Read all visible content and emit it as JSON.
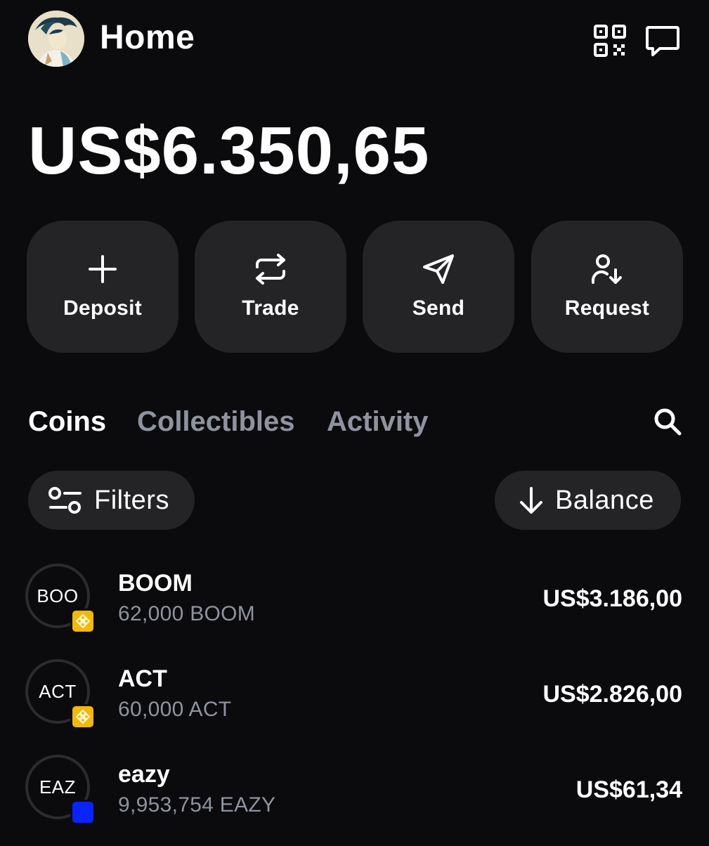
{
  "header": {
    "title": "Home",
    "avatar_icon": "avatar-illustration",
    "qr_icon": "qr-code-icon",
    "messages_icon": "chat-bubble-icon"
  },
  "balance": {
    "total": "US$6.350,65"
  },
  "actions": [
    {
      "label": "Deposit",
      "icon": "plus-icon"
    },
    {
      "label": "Trade",
      "icon": "swap-icon"
    },
    {
      "label": "Send",
      "icon": "send-icon"
    },
    {
      "label": "Request",
      "icon": "request-user-icon"
    }
  ],
  "tabs": [
    {
      "label": "Coins",
      "active": true
    },
    {
      "label": "Collectibles",
      "active": false
    },
    {
      "label": "Activity",
      "active": false
    }
  ],
  "controls": {
    "filters_label": "Filters",
    "sort_label": "Balance"
  },
  "coins": [
    {
      "logo_text": "BOO",
      "name": "BOOM",
      "amount": "62,000 BOOM",
      "value": "US$3.186,00",
      "chain": "bnb",
      "chain_color": "#f0b90b"
    },
    {
      "logo_text": "ACT",
      "name": "ACT",
      "amount": "60,000 ACT",
      "value": "US$2.826,00",
      "chain": "bnb",
      "chain_color": "#f0b90b"
    },
    {
      "logo_text": "EAZ",
      "name": "eazy",
      "amount": "9,953,754 EAZY",
      "value": "US$61,34",
      "chain": "base",
      "chain_color": "#0c22ff"
    }
  ],
  "colors": {
    "background": "#0b0b0d",
    "surface": "#242427",
    "text_primary": "#ffffff",
    "text_secondary": "#8e939f"
  }
}
